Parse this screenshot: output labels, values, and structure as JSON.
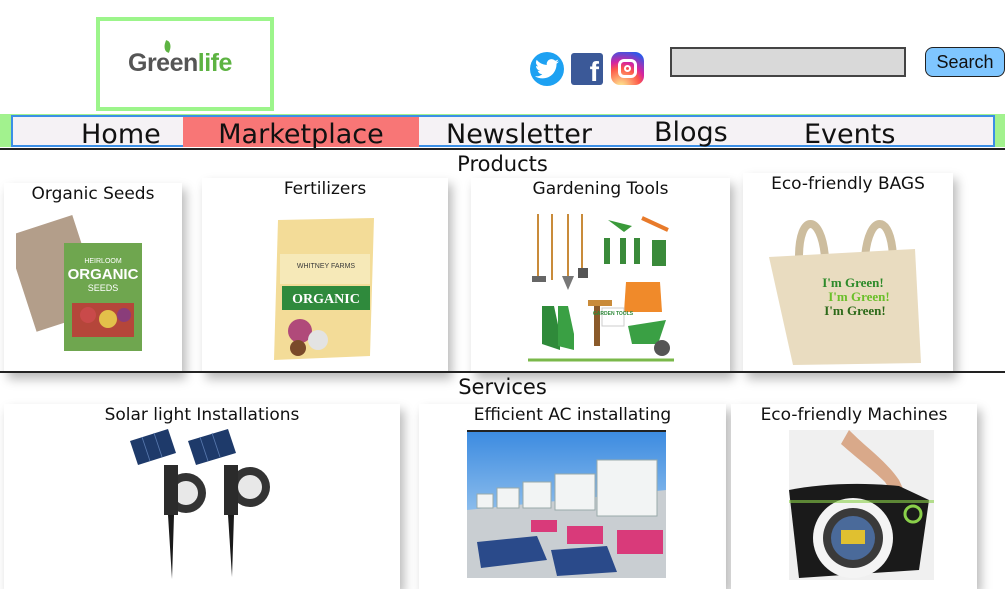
{
  "header": {
    "logo": {
      "part1": "Green",
      "part2": "life"
    },
    "social": [
      "twitter-icon",
      "facebook-icon",
      "instagram-icon"
    ],
    "search": {
      "value": "",
      "placeholder": "",
      "button_label": "Search"
    }
  },
  "nav": {
    "items": [
      {
        "label": "Home",
        "active": false
      },
      {
        "label": "Marketplace",
        "active": true
      },
      {
        "label": "Newsletter",
        "active": false
      },
      {
        "label": "Blogs",
        "active": false
      },
      {
        "label": "Events",
        "active": false
      }
    ]
  },
  "products": {
    "title": "Products",
    "items": [
      {
        "label": "Organic Seeds",
        "image": "organic-seeds-packet",
        "pack_line1": "HEIRLOOM",
        "pack_line2": "ORGANIC",
        "pack_line3": "SEEDS"
      },
      {
        "label": "Fertilizers",
        "image": "fertilizer-bag",
        "bag_brand": "WHITNEY FARMS",
        "bag_text": "ORGANIC"
      },
      {
        "label": "Gardening Tools",
        "image": "gardening-tools",
        "sign_text": "GARDEN TOOLS"
      },
      {
        "label": "Eco-friendly BAGS",
        "image": "tote-bag",
        "bag_lines": [
          "I'm Green!",
          "I'm Green!",
          "I'm Green!"
        ]
      }
    ]
  },
  "services": {
    "title": "Services",
    "items": [
      {
        "label": "Solar light Installations",
        "image": "solar-lights"
      },
      {
        "label": "Efficient AC installating",
        "image": "rooftop-ac-units"
      },
      {
        "label": "Eco-friendly Machines",
        "image": "bike-washing-machine"
      }
    ]
  },
  "colors": {
    "logo_border": "#9cf58b",
    "nav_active": "#f87676",
    "nav_border": "#3b8fe6",
    "search_button": "#7fc6ff",
    "brand_green": "#5db342"
  }
}
